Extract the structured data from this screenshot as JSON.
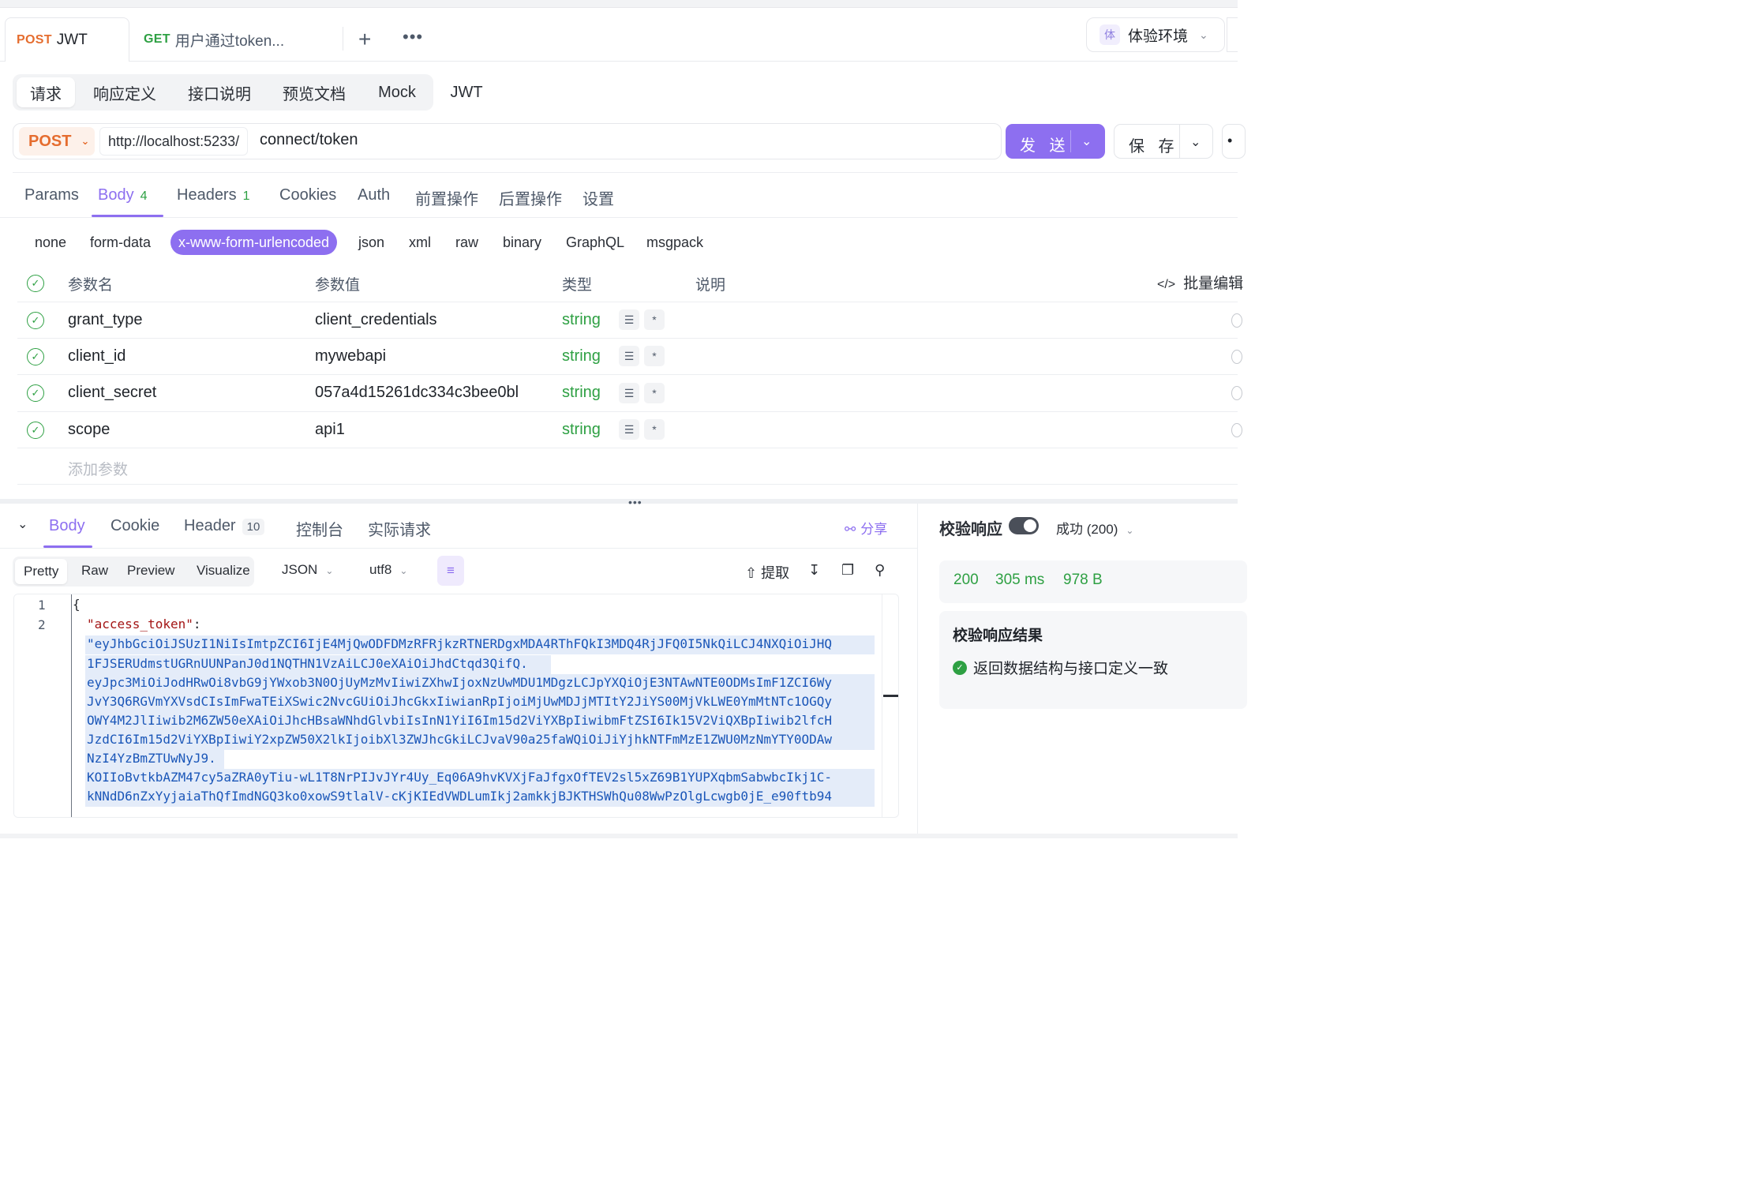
{
  "tabs": [
    {
      "method": "POST",
      "title": "JWT"
    },
    {
      "method": "GET",
      "title": "用户通过token..."
    }
  ],
  "env": {
    "tag": "体",
    "name": "体验环境"
  },
  "subtabs": [
    "请求",
    "响应定义",
    "接口说明",
    "预览文档",
    "Mock",
    "JWT"
  ],
  "request": {
    "method": "POST",
    "base_url": "http://localhost:5233/",
    "path": "connect/token",
    "send_label": "发 送",
    "save_label": "保 存"
  },
  "param_tabs": [
    {
      "label": "Params",
      "count": ""
    },
    {
      "label": "Body",
      "count": "4"
    },
    {
      "label": "Headers",
      "count": "1"
    },
    {
      "label": "Cookies",
      "count": ""
    },
    {
      "label": "Auth",
      "count": ""
    },
    {
      "label": "前置操作",
      "count": ""
    },
    {
      "label": "后置操作",
      "count": ""
    },
    {
      "label": "设置",
      "count": ""
    }
  ],
  "body_types": [
    "none",
    "form-data",
    "x-www-form-urlencoded",
    "json",
    "xml",
    "raw",
    "binary",
    "GraphQL",
    "msgpack"
  ],
  "table": {
    "headers": [
      "参数名",
      "参数值",
      "类型",
      "说明"
    ],
    "batch_edit": "批量编辑",
    "rows": [
      {
        "name": "grant_type",
        "value": "client_credentials",
        "type": "string"
      },
      {
        "name": "client_id",
        "value": "mywebapi",
        "type": "string"
      },
      {
        "name": "client_secret",
        "value": "057a4d15261dc334c3bee0bl",
        "type": "string"
      },
      {
        "name": "scope",
        "value": "api1",
        "type": "string"
      }
    ],
    "add_param": "添加参数"
  },
  "response": {
    "tabs": [
      {
        "label": "Body",
        "count": ""
      },
      {
        "label": "Cookie",
        "count": ""
      },
      {
        "label": "Header",
        "count": "10"
      },
      {
        "label": "控制台",
        "count": ""
      },
      {
        "label": "实际请求",
        "count": ""
      }
    ],
    "share": "分享",
    "formats": [
      "Pretty",
      "Raw",
      "Preview",
      "Visualize"
    ],
    "lang": "JSON",
    "encoding": "utf8",
    "extract": "提取",
    "code": {
      "line1": "{",
      "key": "\"access_token\"",
      "colon": ":",
      "token_lines": [
        "\"eyJhbGciOiJSUzI1NiIsImtpZCI6IjE4MjQwODFDMzRFRjkzRTNERDgxMDA4RThFQkI3MDQ4RjJFQ0I5NkQiLCJ4NXQiOiJHQ",
        "1FJSERUdmstUGRnUUNPanJ0d1NQTHN1VzAiLCJ0eXAiOiJhdCtqd3QifQ.",
        "eyJpc3MiOiJodHRwOi8vbG9jYWxob3N0OjUyMzMvIiwiZXhwIjoxNzUwMDU1MDgzLCJpYXQiOjE3NTAwNTE0ODMsImF1ZCI6Wy",
        "JvY3Q6RGVmYXVsdCIsImFwaTEiXSwic2NvcGUiOiJhcGkxIiwianRpIjoiMjUwMDJjMTItY2JiYS00MjVkLWE0YmMtNTc1OGQy",
        "OWY4M2JlIiwib2M6ZW50eXAiOiJhcHBsaWNhdGlvbiIsInN1YiI6Im15d2ViYXBpIiwibmFtZSI6Ik15V2ViQXBpIiwib2lfcH",
        "JzdCI6Im15d2ViYXBpIiwiY2xpZW50X2lkIjoibXl3ZWJhcGkiLCJvaV90a25faWQiOiJiYjhkNTFmMzE1ZWU0MzNmYTY0ODAw",
        "NzI4YzBmZTUwNyJ9.",
        "KOIIoBvtkbAZM47cy5aZRA0yTiu-wL1T8NrPIJvJYr4Uy_Eq06A9hvKVXjFaJfgxOfTEV2sl5xZ69B1YUPXqbmSabwbcIkj1C-",
        "kNNdD6nZxYyjaiaThQfImdNGQ3ko0xowS9tlalV-cKjKIEdVWDLumIkj2amkkjBJKTHSWhQu08WwPzOlgLcwgb0jE_e90ftb94"
      ]
    }
  },
  "validation": {
    "title": "校验响应",
    "status": "成功 (200)",
    "status_code": "200",
    "time": "305 ms",
    "size": "978 B",
    "result_title": "校验响应结果",
    "result_text": "返回数据结构与接口定义一致"
  },
  "colors": {
    "accent": "#8d6ff0",
    "post": "#e56d2f",
    "get": "#2ea043",
    "string": "#2ea043"
  }
}
